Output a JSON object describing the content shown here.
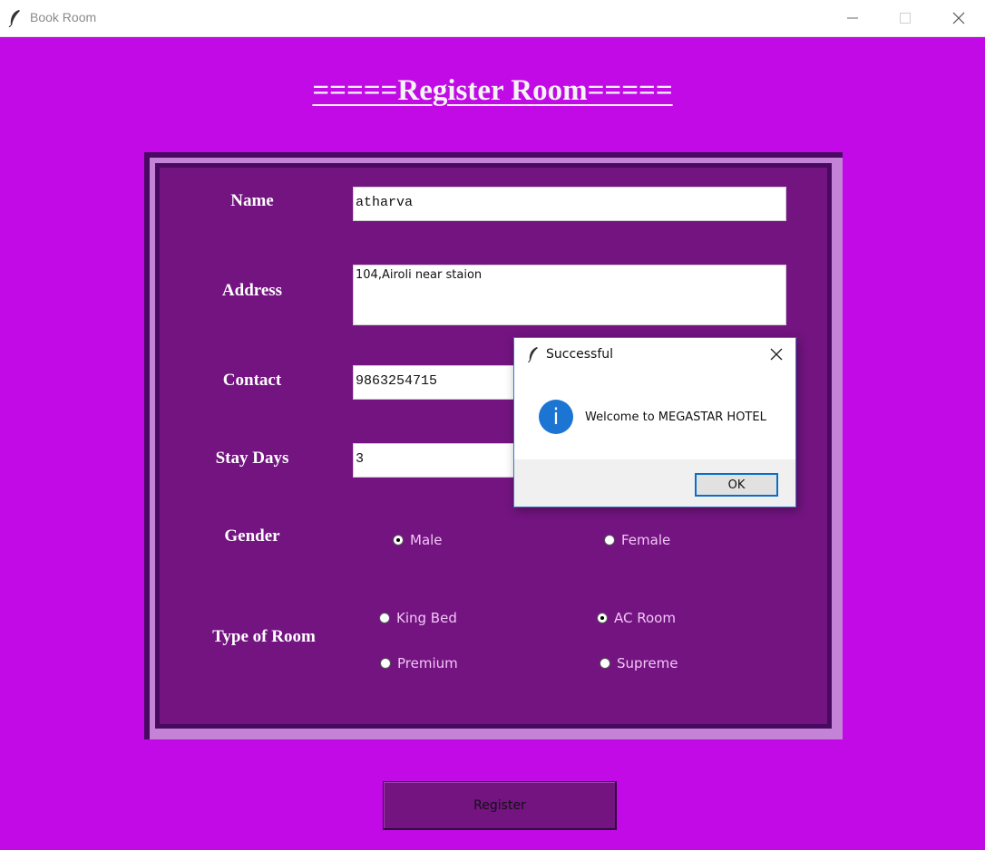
{
  "window": {
    "title": "Book Room",
    "controls": [
      "minimize-icon",
      "maximize-icon",
      "close-icon"
    ],
    "app_icon": "feather-icon"
  },
  "heading": "=====Register Room=====",
  "form": {
    "name_label": "Name",
    "name_value": "atharva",
    "address_label": "Address",
    "address_value": "104,Airoli near staion",
    "contact_label": "Contact",
    "contact_value": "9863254715",
    "stay_label": "Stay Days",
    "stay_value": "3",
    "gender_label": "Gender",
    "gender_options": [
      {
        "label": "Male",
        "selected": true
      },
      {
        "label": "Female",
        "selected": false
      }
    ],
    "room_label": "Type of Room",
    "room_options": [
      {
        "label": "King Bed",
        "selected": false
      },
      {
        "label": "AC Room",
        "selected": true
      },
      {
        "label": "Premium",
        "selected": false
      },
      {
        "label": "Supreme",
        "selected": false
      }
    ]
  },
  "register_button": "Register",
  "dialog": {
    "title": "Successful",
    "message": "Welcome to MEGASTAR HOTEL",
    "ok_label": "OK",
    "icon": "info-icon"
  },
  "colors": {
    "background": "#c10ae6",
    "panel": "#731481",
    "frame_dark": "#480a60",
    "frame_light": "#c583d7",
    "info_blue": "#1c75d2"
  }
}
